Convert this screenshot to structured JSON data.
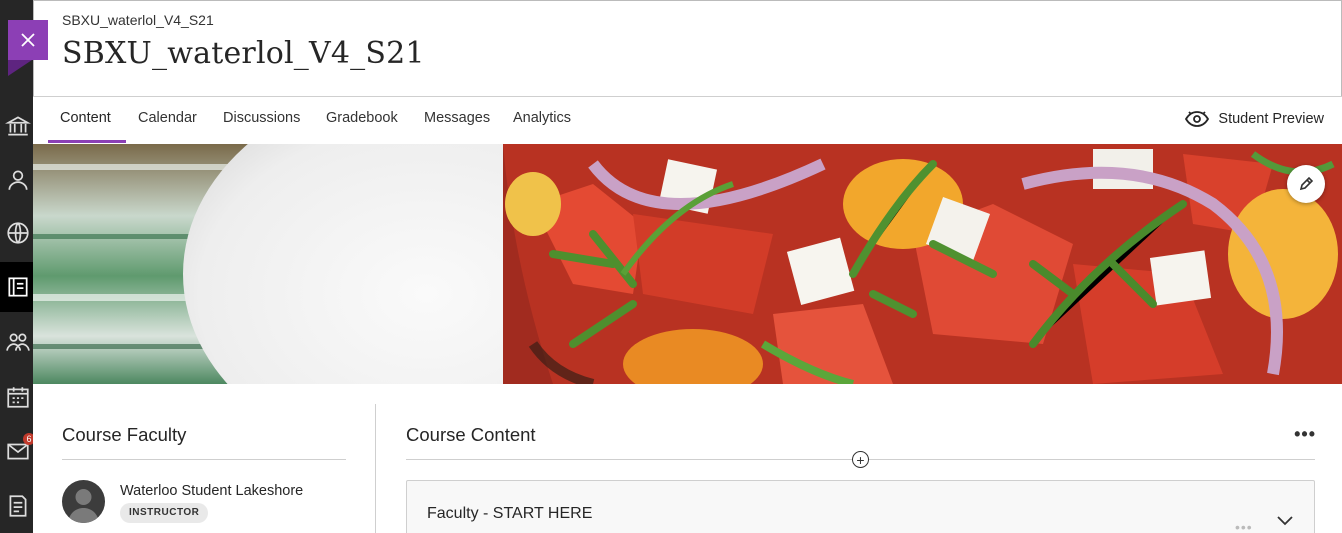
{
  "breadcrumb": "SBXU_waterlol_V4_S21",
  "course_title": "SBXU_waterlol_V4_S21",
  "tabs": [
    {
      "label": "Content"
    },
    {
      "label": "Calendar"
    },
    {
      "label": "Discussions"
    },
    {
      "label": "Gradebook"
    },
    {
      "label": "Messages"
    },
    {
      "label": "Analytics"
    }
  ],
  "active_tab": "Content",
  "student_preview_label": "Student Preview",
  "rail": {
    "icons": [
      "institution-icon",
      "user-icon",
      "globe-icon",
      "courses-icon",
      "groups-icon",
      "calendar-icon",
      "messages-icon",
      "grades-icon"
    ],
    "messages_badge": "6"
  },
  "faculty": {
    "heading": "Course Faculty",
    "members": [
      {
        "name": "Waterloo Student Lakeshore",
        "role": "INSTRUCTOR"
      }
    ]
  },
  "course_content": {
    "heading": "Course Content",
    "more_label": "•••",
    "items": [
      {
        "title": "Faculty - START HERE"
      }
    ]
  },
  "colors": {
    "accent": "#8c3fb5",
    "rail": "#262626"
  }
}
